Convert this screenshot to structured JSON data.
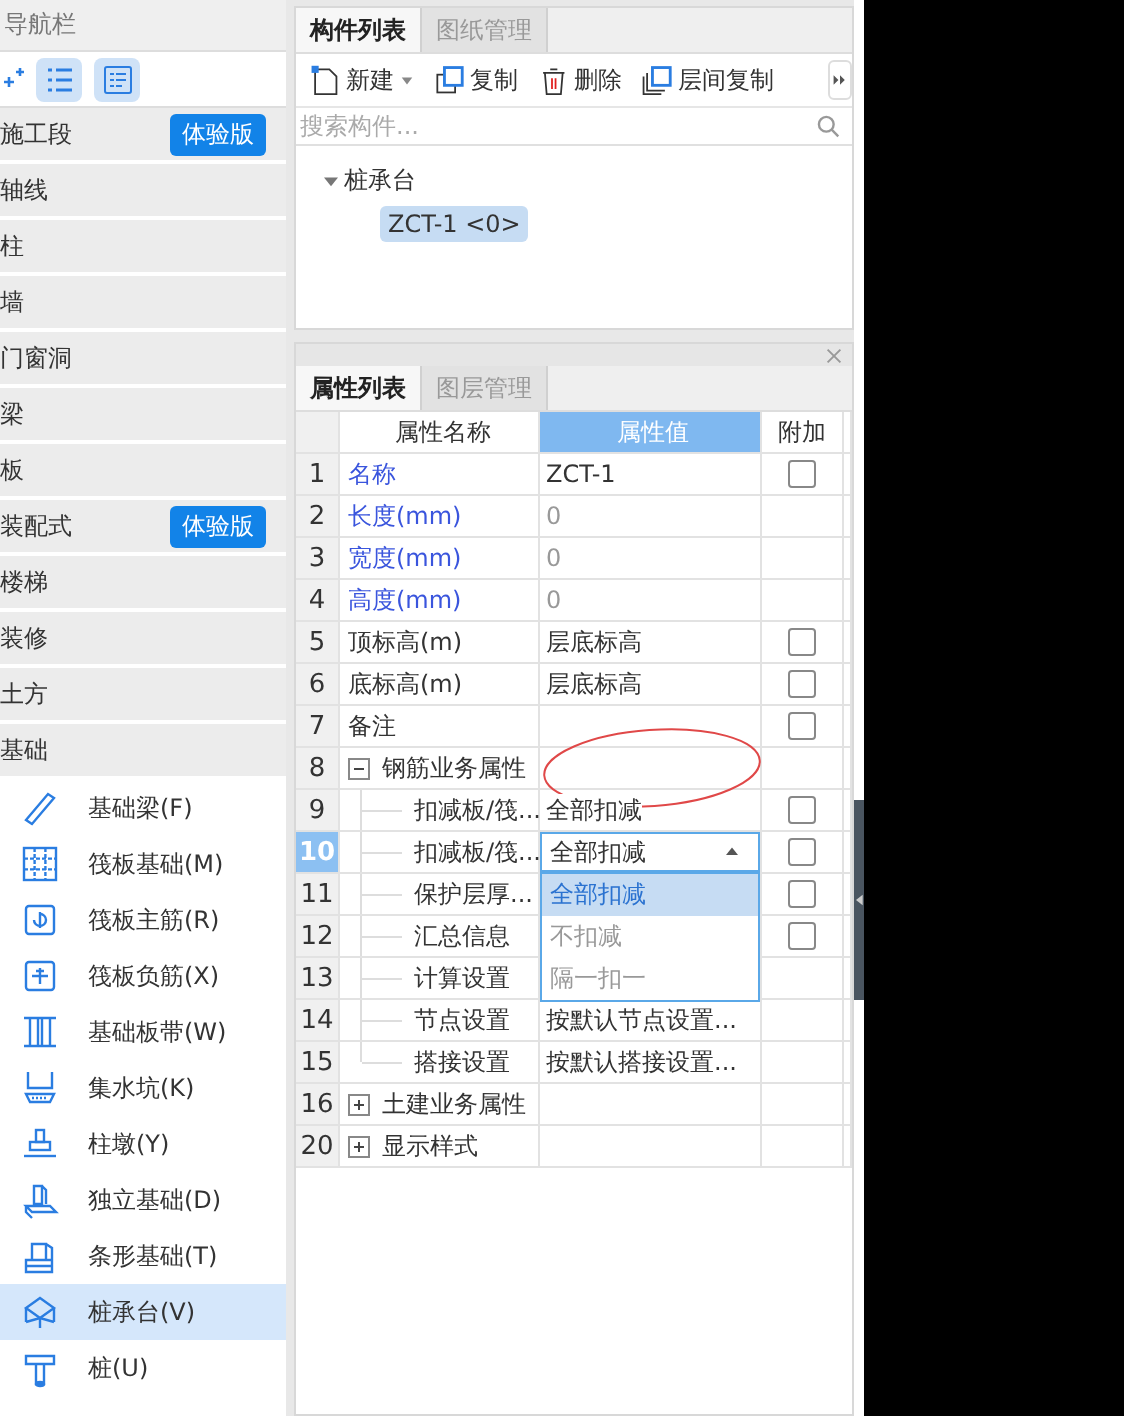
{
  "navigation": {
    "title": "导航栏",
    "categories": [
      {
        "label": "施工段",
        "badge": "体验版"
      },
      {
        "label": "轴线"
      },
      {
        "label": "柱"
      },
      {
        "label": "墙"
      },
      {
        "label": "门窗洞"
      },
      {
        "label": "梁"
      },
      {
        "label": "板"
      },
      {
        "label": "装配式",
        "badge": "体验版"
      },
      {
        "label": "楼梯"
      },
      {
        "label": "装修"
      },
      {
        "label": "土方"
      },
      {
        "label": "基础",
        "children": [
          {
            "label": "基础梁(F)",
            "selected": false
          },
          {
            "label": "筏板基础(M)",
            "selected": false
          },
          {
            "label": "筏板主筋(R)",
            "selected": false
          },
          {
            "label": "筏板负筋(X)",
            "selected": false
          },
          {
            "label": "基础板带(W)",
            "selected": false
          },
          {
            "label": "集水坑(K)",
            "selected": false
          },
          {
            "label": "柱墩(Y)",
            "selected": false
          },
          {
            "label": "独立基础(D)",
            "selected": false
          },
          {
            "label": "条形基础(T)",
            "selected": false
          },
          {
            "label": "桩承台(V)",
            "selected": true
          },
          {
            "label": "桩(U)",
            "selected": false
          }
        ]
      }
    ]
  },
  "component_panel": {
    "tabs": [
      {
        "label": "构件列表",
        "selected": true
      },
      {
        "label": "图纸管理",
        "selected": false
      }
    ],
    "toolbar": [
      {
        "kind": "new",
        "label": "新建"
      },
      {
        "kind": "copy",
        "label": "复制"
      },
      {
        "kind": "delete",
        "label": "删除"
      },
      {
        "kind": "floor_copy",
        "label": "层间复制"
      }
    ],
    "search": {
      "placeholder": "搜索构件..."
    },
    "tree": [
      {
        "label": "桩承台",
        "expanded": true,
        "children": [
          {
            "label": "ZCT-1 <0>",
            "selected": true
          }
        ]
      }
    ]
  },
  "property_panel": {
    "tabs": [
      {
        "label": "属性列表",
        "selected": true
      },
      {
        "label": "图层管理",
        "selected": false
      }
    ],
    "table": {
      "columns": [
        {
          "label": "属性名称",
          "selected": false
        },
        {
          "label": "属性值",
          "selected": true
        },
        {
          "label": "附加",
          "selected": false
        }
      ],
      "rows": [
        {
          "number": "1",
          "name": "名称",
          "value": "ZCT-1",
          "public": true,
          "selected": false,
          "checked": false
        },
        {
          "number": "2",
          "name": "长度(mm)",
          "value": "0",
          "public": true,
          "readonly": true,
          "selected": false
        },
        {
          "number": "3",
          "name": "宽度(mm)",
          "value": "0",
          "public": true,
          "readonly": true,
          "selected": false
        },
        {
          "number": "4",
          "name": "高度(mm)",
          "value": "0",
          "public": true,
          "readonly": true,
          "selected": false
        },
        {
          "number": "5",
          "name": "顶标高(m)",
          "value": "层底标高",
          "public": false,
          "selected": false,
          "checked": false
        },
        {
          "number": "6",
          "name": "底标高(m)",
          "value": "层底标高",
          "public": false,
          "selected": false,
          "checked": false
        },
        {
          "number": "7",
          "name": "备注",
          "public": false,
          "selected": false,
          "checked": false
        },
        {
          "number": "8",
          "name": "钢筋业务属性",
          "public": false,
          "selected": false,
          "expanded": true,
          "children": [
            {
              "number": "9",
              "name": "扣减板/筏...",
              "value": "全部扣减",
              "public": false,
              "selected": false,
              "checked": false
            },
            {
              "number": "10",
              "name": "扣减板/筏...",
              "value": "全部扣减",
              "public": false,
              "selected": true,
              "editing": true,
              "checked": false
            },
            {
              "number": "11",
              "name": "保护层厚...",
              "public": false,
              "selected": false,
              "checked": false
            },
            {
              "number": "12",
              "name": "汇总信息",
              "public": false,
              "selected": false,
              "checked": false
            },
            {
              "number": "13",
              "name": "计算设置",
              "public": false,
              "selected": false
            },
            {
              "number": "14",
              "name": "节点设置",
              "value": "按默认节点设置...",
              "public": false,
              "selected": false
            },
            {
              "number": "15",
              "name": "搭接设置",
              "value": "按默认搭接设置...",
              "public": false,
              "selected": false
            }
          ]
        },
        {
          "number": "16",
          "name": "土建业务属性",
          "public": false,
          "selected": false,
          "expanded": false
        },
        {
          "number": "20",
          "name": "显示样式",
          "public": false,
          "selected": false,
          "expanded": false
        }
      ],
      "dropdown": {
        "options": [
          {
            "label": "全部扣减",
            "selected": true
          },
          {
            "label": "不扣减",
            "selected": false
          },
          {
            "label": "隔一扣一",
            "selected": false
          }
        ]
      }
    }
  }
}
